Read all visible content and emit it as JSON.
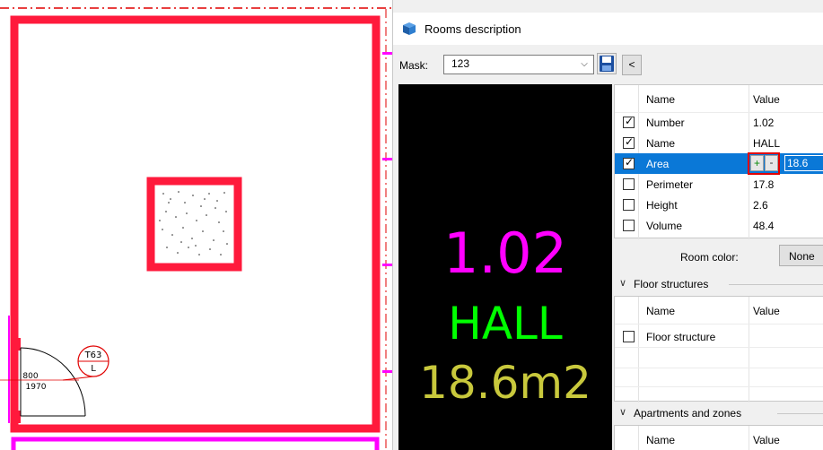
{
  "cad": {
    "door_tag": "T63",
    "door_tag_sub": "L",
    "door_width": "800",
    "door_height": "1970"
  },
  "dialog": {
    "title": "Rooms description",
    "title_icon": "rooms-3d-box-icon",
    "mask_label": "Mask:",
    "mask_value": "123",
    "save_icon": "floppy-disk-icon",
    "back_label": "<",
    "preview": {
      "number": "1.02",
      "name": "HALL",
      "area": "18.6m2",
      "colors": {
        "number": "#ff00ff",
        "name": "#00ff00",
        "area": "#c8c83c"
      }
    },
    "properties": {
      "header_name": "Name",
      "header_value": "Value",
      "rows": [
        {
          "name": "Number",
          "value": "1.02",
          "checked": true
        },
        {
          "name": "Name",
          "value": "HALL",
          "checked": true
        },
        {
          "name": "Area",
          "value": "18.6",
          "checked": true,
          "selected": true
        },
        {
          "name": "Perimeter",
          "value": "17.8",
          "checked": false
        },
        {
          "name": "Height",
          "value": "2.6",
          "checked": false
        },
        {
          "name": "Volume",
          "value": "48.4",
          "checked": false
        }
      ],
      "plus_label": "+",
      "minus_label": "-",
      "room_color_label": "Room color:",
      "room_color_value": "None",
      "selection_color": "#0a78d7"
    },
    "floor_structures": {
      "title": "Floor structures",
      "header_name": "Name",
      "header_value": "Value",
      "rows": [
        {
          "name": "Floor structure",
          "value": "",
          "checked": false
        }
      ]
    },
    "apartments": {
      "title": "Apartments and zones",
      "header_name": "Name",
      "header_value": "Value"
    }
  }
}
